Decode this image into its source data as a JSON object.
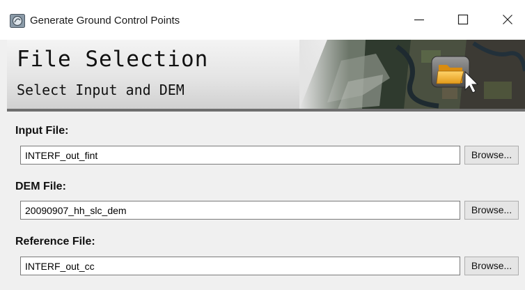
{
  "window": {
    "title": "Generate Ground Control Points",
    "controls": {
      "minimize": "minimize-icon",
      "maximize": "maximize-icon",
      "close": "close-icon"
    }
  },
  "header": {
    "title": "File Selection",
    "subtitle": "Select Input and DEM",
    "image_icon": "folder-icon"
  },
  "fields": [
    {
      "label": "Input File:",
      "value": "INTERF_out_fint",
      "button": "Browse..."
    },
    {
      "label": "DEM File:",
      "value": "20090907_hh_slc_dem",
      "button": "Browse..."
    },
    {
      "label": "Reference File:",
      "value": "INTERF_out_cc",
      "button": "Browse..."
    }
  ],
  "colors": {
    "window_bg": "#f0f0f0",
    "titlebar_bg": "#ffffff",
    "input_border": "#7a7a7a",
    "button_bg": "#e5e5e5"
  }
}
